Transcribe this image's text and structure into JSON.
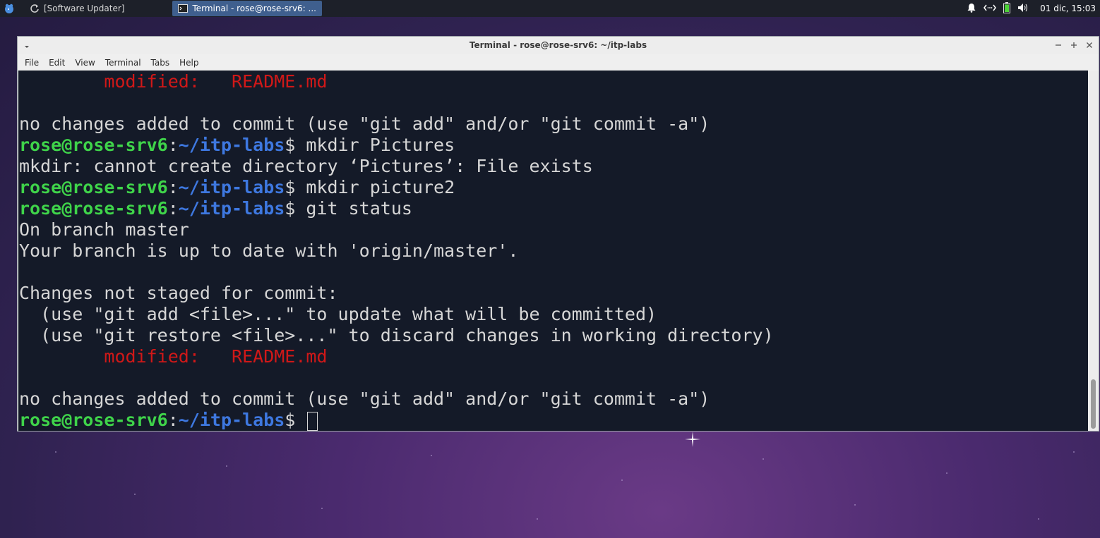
{
  "panel": {
    "tasks": [
      {
        "label": "[Software Updater]",
        "icon": "refresh-icon"
      },
      {
        "label": "Terminal - rose@rose-srv6: ...",
        "icon": "terminal-icon"
      }
    ],
    "clock": "01 dic, 15:03",
    "battery_color": "#4cd137"
  },
  "window": {
    "title": "Terminal - rose@rose-srv6: ~/itp-labs",
    "menu": [
      "File",
      "Edit",
      "View",
      "Terminal",
      "Tabs",
      "Help"
    ]
  },
  "terminal": {
    "prompt_user": "rose@rose-srv6",
    "prompt_sep": ":",
    "prompt_path": "~/itp-labs",
    "prompt_end": "$ ",
    "lines": [
      {
        "indent": "        ",
        "text": "modified:   README.md",
        "color": "red"
      },
      {
        "text": ""
      },
      {
        "text": "no changes added to commit (use \"git add\" and/or \"git commit -a\")"
      },
      {
        "prompt": true,
        "text": "mkdir Pictures"
      },
      {
        "text": "mkdir: cannot create directory ‘Pictures’: File exists"
      },
      {
        "prompt": true,
        "text": "mkdir picture2"
      },
      {
        "prompt": true,
        "text": "git status"
      },
      {
        "text": "On branch master"
      },
      {
        "text": "Your branch is up to date with 'origin/master'."
      },
      {
        "text": ""
      },
      {
        "text": "Changes not staged for commit:"
      },
      {
        "text": "  (use \"git add <file>...\" to update what will be committed)"
      },
      {
        "text": "  (use \"git restore <file>...\" to discard changes in working directory)"
      },
      {
        "indent": "        ",
        "text": "modified:   README.md",
        "color": "red"
      },
      {
        "text": ""
      },
      {
        "text": "no changes added to commit (use \"git add\" and/or \"git commit -a\")"
      },
      {
        "prompt": true,
        "text": "",
        "cursor": true
      }
    ],
    "colors": {
      "user": "#3fd44a",
      "path": "#3e78e0",
      "modified": "#d01818",
      "text": "#d6d6d6",
      "background": "#141a28"
    }
  }
}
